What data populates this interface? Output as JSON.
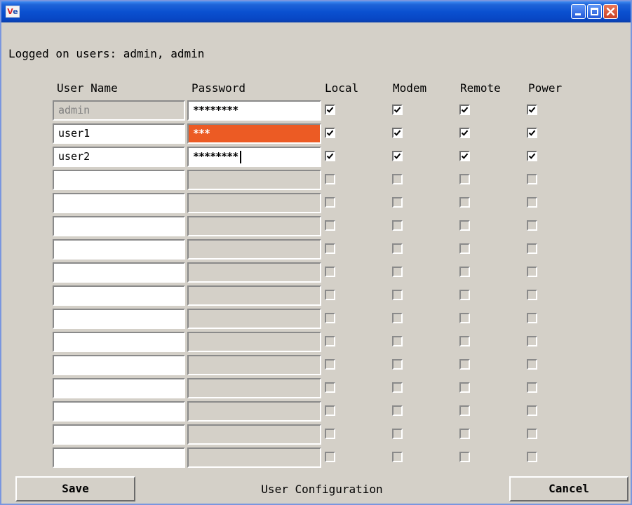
{
  "app_icon": {
    "v": "V",
    "e": "e"
  },
  "logged_on": "Logged on users: admin, admin",
  "headers": [
    "User Name",
    "Password",
    "Local",
    "Modem",
    "Remote",
    "Power"
  ],
  "rows": [
    {
      "username": "admin",
      "password": "********",
      "username_disabled": true,
      "password_state": "normal",
      "perms": [
        true,
        true,
        true,
        true
      ]
    },
    {
      "username": "user1",
      "password": "***",
      "username_disabled": false,
      "password_state": "active",
      "perms": [
        true,
        true,
        true,
        true
      ]
    },
    {
      "username": "user2",
      "password": "********",
      "username_disabled": false,
      "password_state": "editing",
      "perms": [
        true,
        true,
        true,
        true
      ]
    },
    {
      "username": "",
      "password": "",
      "username_disabled": false,
      "password_state": "empty",
      "perms": [
        false,
        false,
        false,
        false
      ]
    },
    {
      "username": "",
      "password": "",
      "username_disabled": false,
      "password_state": "empty",
      "perms": [
        false,
        false,
        false,
        false
      ]
    },
    {
      "username": "",
      "password": "",
      "username_disabled": false,
      "password_state": "empty",
      "perms": [
        false,
        false,
        false,
        false
      ]
    },
    {
      "username": "",
      "password": "",
      "username_disabled": false,
      "password_state": "empty",
      "perms": [
        false,
        false,
        false,
        false
      ]
    },
    {
      "username": "",
      "password": "",
      "username_disabled": false,
      "password_state": "empty",
      "perms": [
        false,
        false,
        false,
        false
      ]
    },
    {
      "username": "",
      "password": "",
      "username_disabled": false,
      "password_state": "empty",
      "perms": [
        false,
        false,
        false,
        false
      ]
    },
    {
      "username": "",
      "password": "",
      "username_disabled": false,
      "password_state": "empty",
      "perms": [
        false,
        false,
        false,
        false
      ]
    },
    {
      "username": "",
      "password": "",
      "username_disabled": false,
      "password_state": "empty",
      "perms": [
        false,
        false,
        false,
        false
      ]
    },
    {
      "username": "",
      "password": "",
      "username_disabled": false,
      "password_state": "empty",
      "perms": [
        false,
        false,
        false,
        false
      ]
    },
    {
      "username": "",
      "password": "",
      "username_disabled": false,
      "password_state": "empty",
      "perms": [
        false,
        false,
        false,
        false
      ]
    },
    {
      "username": "",
      "password": "",
      "username_disabled": false,
      "password_state": "empty",
      "perms": [
        false,
        false,
        false,
        false
      ]
    },
    {
      "username": "",
      "password": "",
      "username_disabled": false,
      "password_state": "empty",
      "perms": [
        false,
        false,
        false,
        false
      ]
    },
    {
      "username": "",
      "password": "",
      "username_disabled": false,
      "password_state": "empty",
      "perms": [
        false,
        false,
        false,
        false
      ]
    }
  ],
  "footer": {
    "save": "Save",
    "title": "User Configuration",
    "cancel": "Cancel"
  },
  "colors": {
    "titlebar": "#0a50d0",
    "window_bg": "#d4d0c8",
    "active_field": "#ec5b24",
    "close_button": "#c84228"
  }
}
